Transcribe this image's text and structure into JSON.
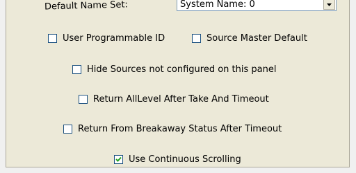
{
  "default_name_set": {
    "label": "Default Name Set:",
    "value": "System Name: 0"
  },
  "options": {
    "user_programmable_id": {
      "label": "User Programmable ID",
      "checked": false
    },
    "source_master_default": {
      "label": "Source Master Default",
      "checked": false
    },
    "hide_sources": {
      "label": "Hide Sources not configured on this panel",
      "checked": false
    },
    "return_alllevel": {
      "label": "Return AllLevel After Take And Timeout",
      "checked": false
    },
    "return_breakaway": {
      "label": "Return From Breakaway Status After Timeout",
      "checked": false
    },
    "continuous_scrolling": {
      "label": "Use Continuous Scrolling",
      "checked": true
    }
  }
}
